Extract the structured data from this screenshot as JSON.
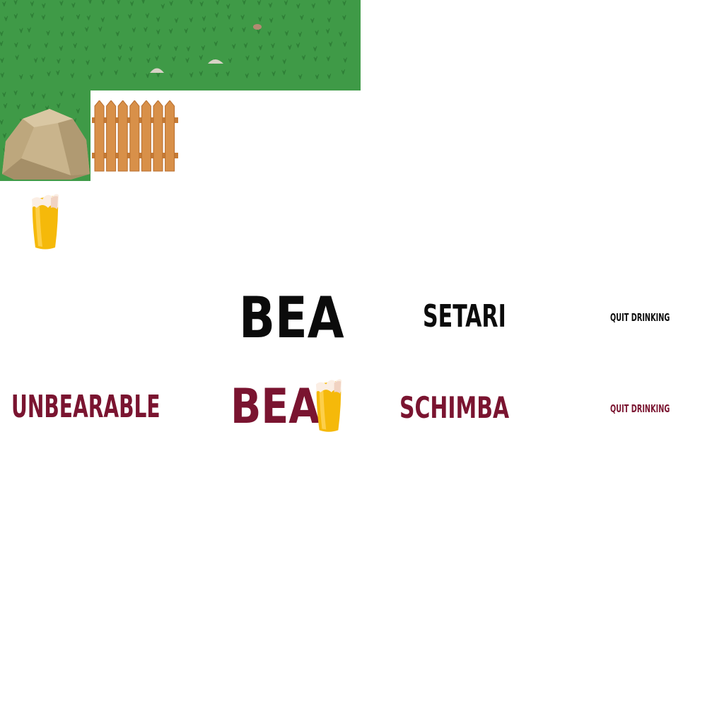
{
  "sprites": {
    "grass_tile": "grass-tile",
    "grass_tile_small": "grass-tile-small",
    "rock": "rock",
    "fence": "wooden-fence",
    "beer_small": "beer-glass",
    "beer_logo": "beer-glass"
  },
  "logos_black": {
    "title": "BEA",
    "setari": "SETARI",
    "quit": "QUIT DRINKING"
  },
  "logos_maroon": {
    "unbearable": "UNBEARABLE",
    "title": "BEA",
    "schimba": "SCHIMBA",
    "quit": "QUIT DRINKING"
  },
  "colors": {
    "grass": "#3f9a47",
    "maroon": "#7a1430",
    "black": "#0b0b0b",
    "beer": "#f4b400",
    "foam": "#fbeee4",
    "wood": "#d89049",
    "rock": "#c9b48c"
  }
}
